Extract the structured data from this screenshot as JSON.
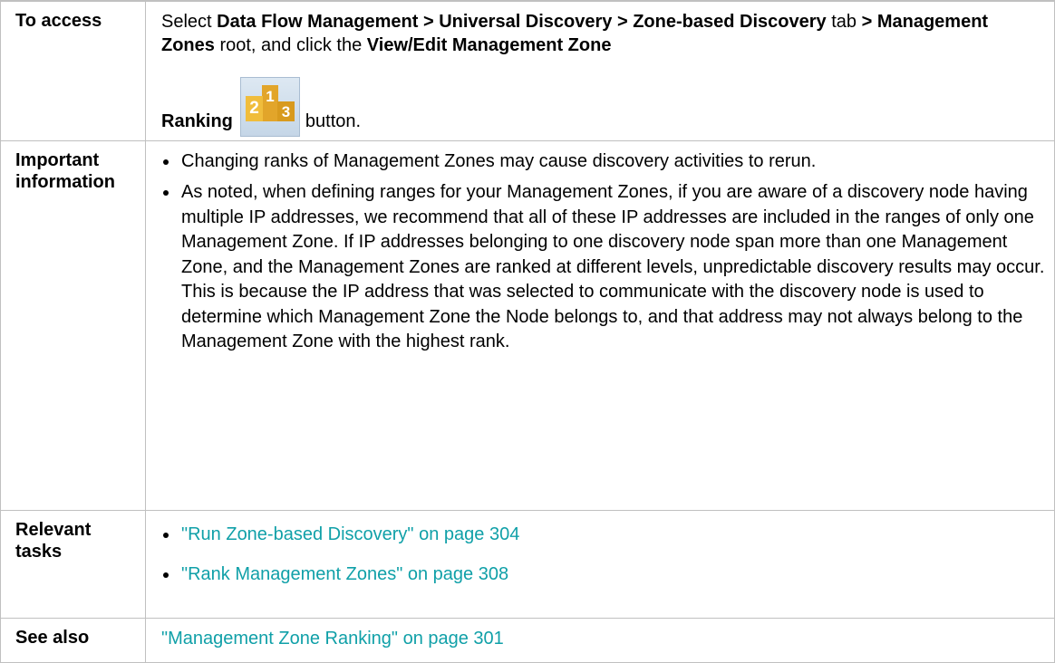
{
  "rows": {
    "access": {
      "label": "To access",
      "select": "Select",
      "path": "Data Flow Management > Universal Discovery > Zone-based Discovery",
      "tab": "tab",
      "gt": ">",
      "zones_root": "Management Zones",
      "root_and_click": "root, and click the",
      "button_name_1": "View/Edit Management Zone",
      "button_name_2": "Ranking",
      "button_word": "button.",
      "icon": "ranking-podium-icon",
      "icon_digits": [
        "2",
        "1",
        "3"
      ]
    },
    "important": {
      "label": "Important information",
      "bullets": [
        "Changing ranks of Management Zones may cause discovery activities to rerun.",
        "As noted, when defining ranges for your Management Zones, if you are aware of a discovery node having multiple IP addresses, we recommend that all of these IP addresses are included in the ranges of only one Management Zone. If IP addresses belonging to one discovery node span more than one Management Zone, and the Management Zones are ranked at different levels, unpredictable discovery results may occur. This is because the IP address that was selected to communicate with the discovery node is used to determine which Management Zone the Node belongs to, and that address may not always belong to the Management Zone with the highest rank."
      ]
    },
    "tasks": {
      "label": "Relevant tasks",
      "links": [
        "\"Run Zone-based Discovery\" on page 304",
        "\"Rank Management Zones\" on page 308"
      ]
    },
    "see_also": {
      "label": "See also",
      "link": "\"Management Zone Ranking\" on page 301"
    }
  },
  "colors": {
    "link": "#10a0a8",
    "border": "#c0c0c0",
    "icon_gold": "#e2a52a"
  }
}
